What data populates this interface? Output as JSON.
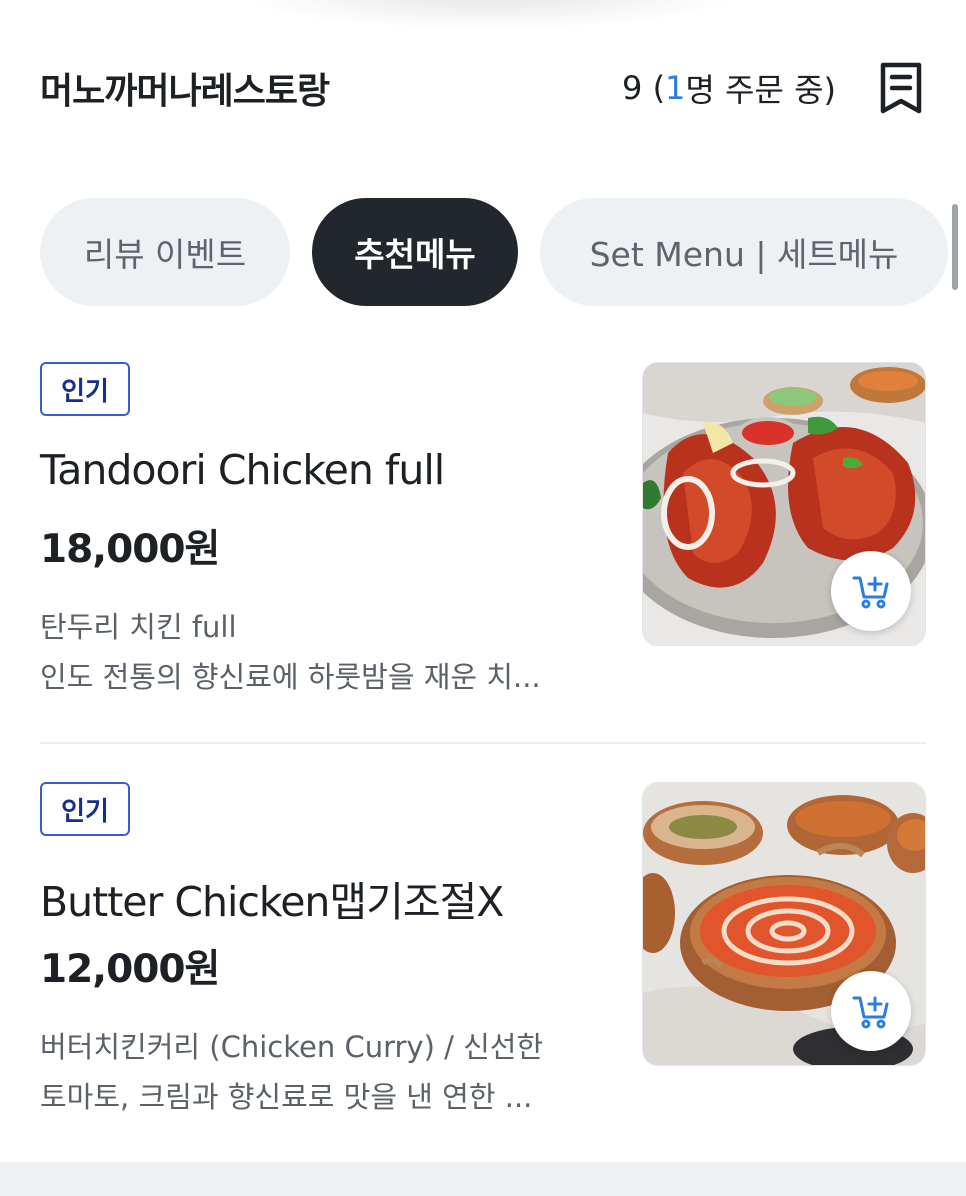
{
  "header": {
    "restaurant_name": "머노까머나레스토랑",
    "order_prefix": "9 (",
    "order_count": "1",
    "order_suffix": "명 주문 중)",
    "receipt_icon": "receipt-icon"
  },
  "tabs": [
    {
      "label": "리뷰 이벤트",
      "active": false
    },
    {
      "label": "추천메뉴",
      "active": true
    },
    {
      "label": "Set Menu | 세트메뉴",
      "active": false
    }
  ],
  "menu": [
    {
      "badge": "인기",
      "name": "Tandoori Chicken full",
      "price": "18,000원",
      "desc_line1": "탄두리 치킨 full",
      "desc_line2": "인도 전통의 향신료에 하룻밤을 재운 치...",
      "image": "tandoori-chicken-photo",
      "cart_icon": "add-to-cart-icon"
    },
    {
      "badge": "인기",
      "name": "Butter Chicken맵기조절X",
      "price": "12,000원",
      "desc_line1": "버터치킨커리 (Chicken Curry) / 신선한",
      "desc_line2": "토마토, 크림과 향신료로 맛을 낸 연한 ...",
      "image": "butter-chicken-photo",
      "cart_icon": "add-to-cart-icon"
    }
  ],
  "colors": {
    "accent_blue": "#2a7de1",
    "badge_border": "#3c5bd1",
    "active_tab": "#22272d",
    "inactive_tab": "#eef1f4"
  }
}
